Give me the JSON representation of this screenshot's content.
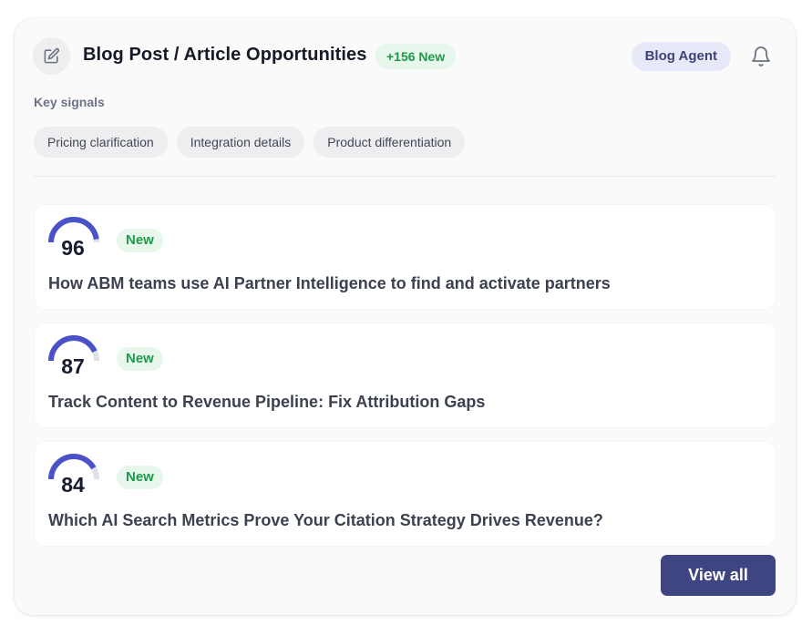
{
  "card": {
    "title": "Blog Post / Article Opportunities",
    "new_count": "+156 New",
    "agent_badge": "Blog Agent",
    "edit_icon": "edit-icon",
    "bell_icon": "bell-icon"
  },
  "signals": {
    "label": "Key signals",
    "chips": [
      "Pricing clarification",
      "Integration details",
      "Product differentiation"
    ]
  },
  "items": [
    {
      "score": "96",
      "score_value": 96,
      "badge": "New",
      "title": "How ABM teams use AI Partner Intelligence to find and activate partners"
    },
    {
      "score": "87",
      "score_value": 87,
      "badge": "New",
      "title": "Track Content to Revenue Pipeline: Fix Attribution Gaps"
    },
    {
      "score": "84",
      "score_value": 84,
      "badge": "New",
      "title": "Which AI Search Metrics Prove Your Citation Strategy Drives Revenue?"
    }
  ],
  "footer": {
    "view_all_label": "View all"
  },
  "colors": {
    "accent": "#3f4580",
    "gauge_fill": "#4b52c7",
    "gauge_track": "#dfe0e8",
    "new_green": "#1e9a4a"
  }
}
